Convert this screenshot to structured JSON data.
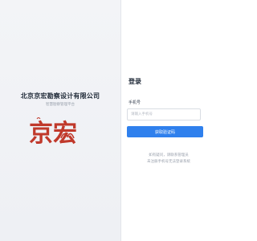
{
  "brand": {
    "company_name": "北京京宏勘察设计有限公司",
    "subtitle": "智慧勘察管理平台",
    "logo_text": "京宏",
    "logo_color": "#c0392b"
  },
  "login": {
    "title": "登录",
    "phone_label": "手机号",
    "phone_placeholder": "请输入手机号",
    "phone_value": "",
    "code_button": "获取验证码",
    "note_line1": "如有疑问，请联系管理员",
    "note_line2": "未注册手机号无法登录系统"
  },
  "colors": {
    "accent": "#2f80ed",
    "left_panel": "#f3f4f7"
  }
}
